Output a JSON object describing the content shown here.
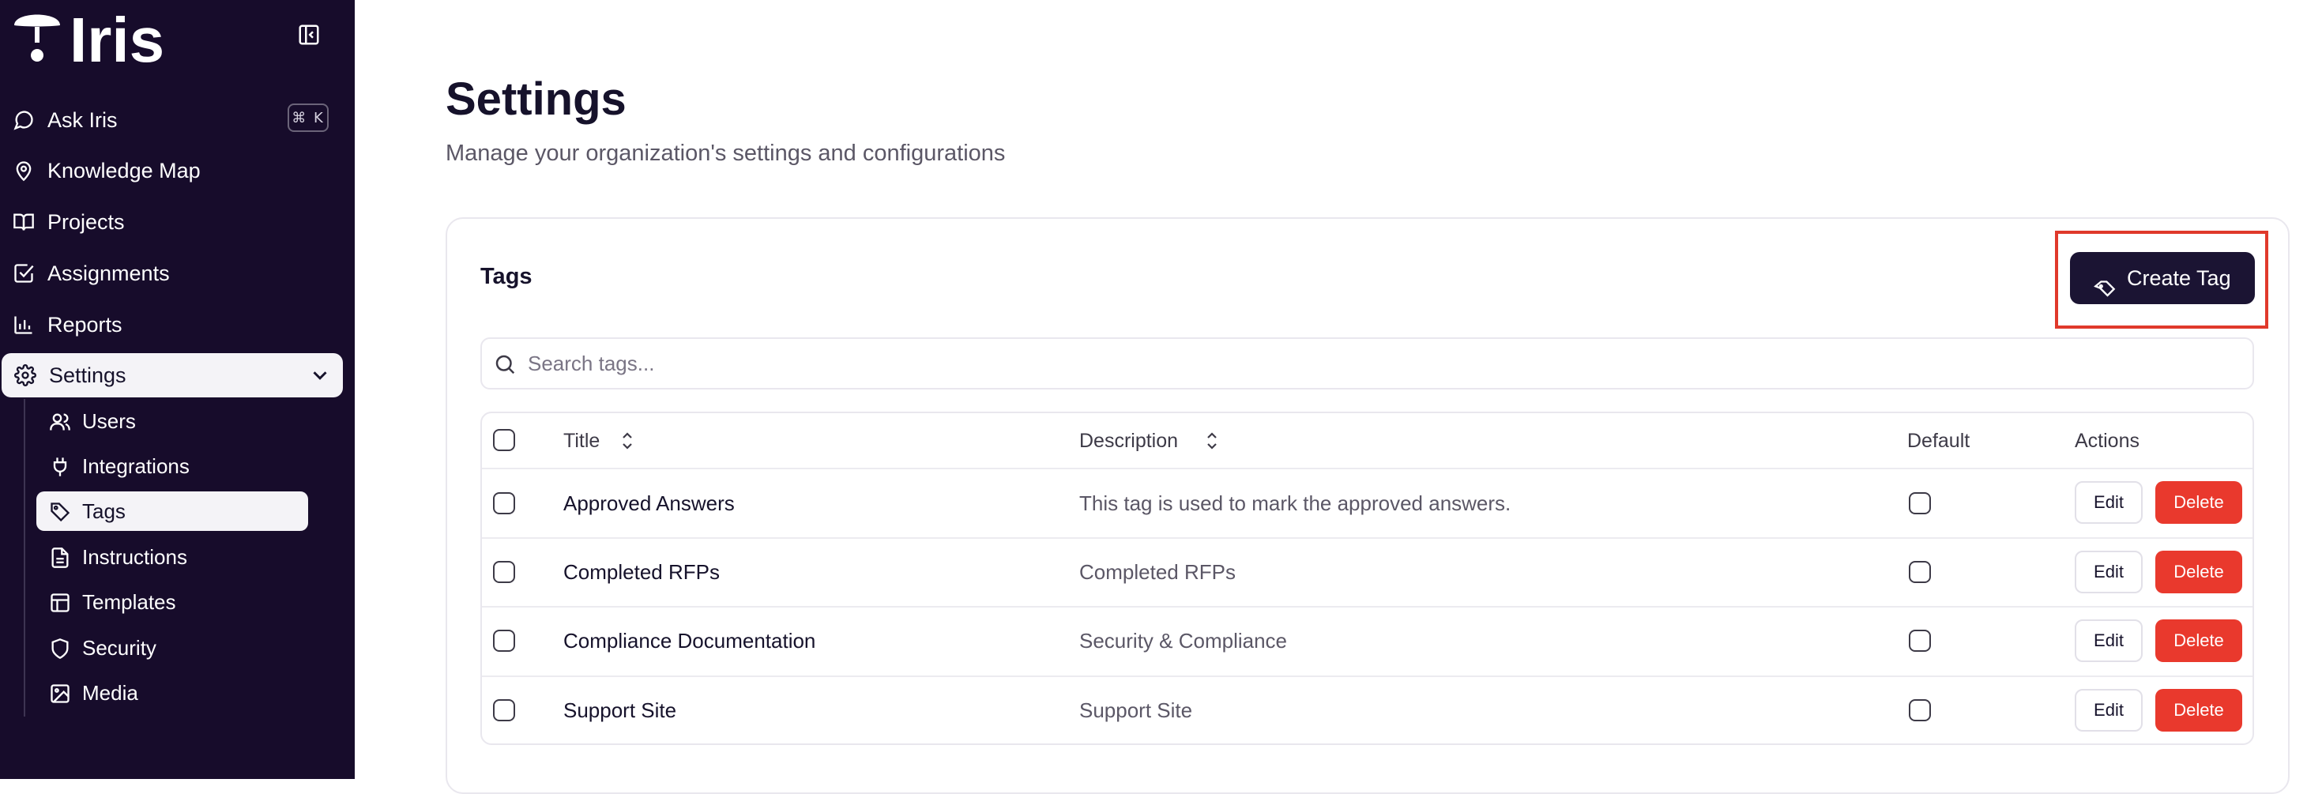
{
  "app": {
    "logo_text": "Iris"
  },
  "sidebar": {
    "shortcut": "⌘ K",
    "items": [
      {
        "label": "Ask Iris",
        "icon": "message-circle-icon"
      },
      {
        "label": "Knowledge Map",
        "icon": "map-pin-icon"
      },
      {
        "label": "Projects",
        "icon": "book-open-icon"
      },
      {
        "label": "Assignments",
        "icon": "checkbox-icon"
      },
      {
        "label": "Reports",
        "icon": "bar-chart-icon"
      },
      {
        "label": "Settings",
        "icon": "gear-icon"
      }
    ],
    "settings_sub": [
      {
        "label": "Users",
        "icon": "users-icon"
      },
      {
        "label": "Integrations",
        "icon": "plug-icon"
      },
      {
        "label": "Tags",
        "icon": "tag-icon"
      },
      {
        "label": "Instructions",
        "icon": "file-text-icon"
      },
      {
        "label": "Templates",
        "icon": "layout-icon"
      },
      {
        "label": "Security",
        "icon": "shield-icon"
      },
      {
        "label": "Media",
        "icon": "image-icon"
      }
    ],
    "active_item": "Settings",
    "active_sub": "Tags"
  },
  "main": {
    "title": "Settings",
    "subtitle": "Manage your organization's settings and configurations",
    "card": {
      "title": "Tags",
      "create_label": "Create Tag",
      "search_placeholder": "Search tags...",
      "columns": {
        "title": "Title",
        "description": "Description",
        "default": "Default",
        "actions": "Actions"
      },
      "rows": [
        {
          "title": "Approved Answers",
          "description": "This tag is used to mark the approved answers.",
          "default": false
        },
        {
          "title": "Completed RFPs",
          "description": "Completed RFPs",
          "default": false
        },
        {
          "title": "Compliance Documentation",
          "description": "Security & Compliance",
          "default": false
        },
        {
          "title": "Support Site",
          "description": "Support Site",
          "default": false
        }
      ],
      "edit_label": "Edit",
      "delete_label": "Delete"
    }
  },
  "colors": {
    "sidebar_bg": "#170c2b",
    "primary_button": "#1b1433",
    "danger": "#e9392d",
    "highlight": "#e0392b"
  }
}
